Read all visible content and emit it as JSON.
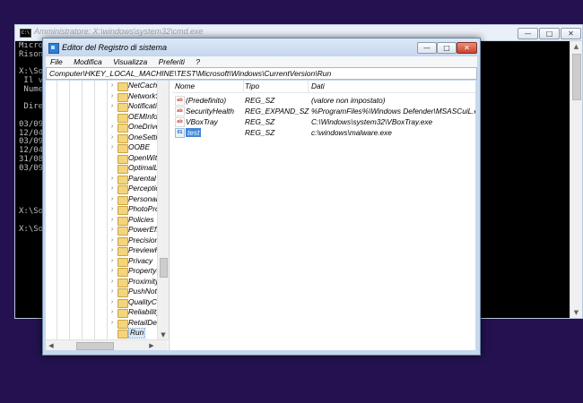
{
  "cmd": {
    "title": "Amministratore: X:\\windows\\system32\\cmd.exe",
    "icon_text": "C:\\",
    "lines": [
      "Micro",
      "Rison",
      "",
      "X:\\So",
      " Il v",
      " Nume",
      "",
      " Dire",
      "",
      "03/09",
      "12/04",
      "03/09",
      "12/04",
      "31/08",
      "03/09",
      "",
      "",
      "",
      "",
      "X:\\So",
      "",
      "X:\\So"
    ]
  },
  "regedit": {
    "title": "Editor del Registro di sistema",
    "menu": [
      "File",
      "Modifica",
      "Visualizza",
      "Preferiti",
      "?"
    ],
    "address": "Computer\\HKEY_LOCAL_MACHINE\\TEST\\Microsoft\\Windows\\CurrentVersion\\Run",
    "tree": [
      {
        "label": "NetCache",
        "expandable": true
      },
      {
        "label": "NetworkSer",
        "expandable": true
      },
      {
        "label": "Notification",
        "expandable": true
      },
      {
        "label": "OEMInform",
        "expandable": false
      },
      {
        "label": "OneDriveRa",
        "expandable": true
      },
      {
        "label": "OneSetting",
        "expandable": true
      },
      {
        "label": "OOBE",
        "expandable": true
      },
      {
        "label": "OpenWith",
        "expandable": false
      },
      {
        "label": "OptimalLay",
        "expandable": false
      },
      {
        "label": "Parental Co",
        "expandable": true
      },
      {
        "label": "PerceptionS",
        "expandable": true
      },
      {
        "label": "Personaliza",
        "expandable": true
      },
      {
        "label": "PhotoPrope",
        "expandable": true
      },
      {
        "label": "Policies",
        "expandable": true
      },
      {
        "label": "PowerEfficie",
        "expandable": true
      },
      {
        "label": "PrecisionTo",
        "expandable": true
      },
      {
        "label": "PreviewHar",
        "expandable": true
      },
      {
        "label": "Privacy",
        "expandable": true
      },
      {
        "label": "PropertySys",
        "expandable": true
      },
      {
        "label": "Proximity",
        "expandable": true
      },
      {
        "label": "PushNotific",
        "expandable": true
      },
      {
        "label": "QualityCon",
        "expandable": true
      },
      {
        "label": "Reliability",
        "expandable": true
      },
      {
        "label": "RetailDemo",
        "expandable": true
      },
      {
        "label": "Run",
        "expandable": false,
        "selected": true
      },
      {
        "label": "RunOnce",
        "expandable": false
      }
    ],
    "columns": {
      "name": "Nome",
      "type": "Tipo",
      "data": "Dati"
    },
    "values": [
      {
        "name": "(Predefinito)",
        "type": "REG_SZ",
        "data": "(valore non impostato)",
        "icon": "string-value-icon",
        "icon_text": "ab"
      },
      {
        "name": "SecurityHealth",
        "type": "REG_EXPAND_SZ",
        "data": "%ProgramFiles%\\Windows Defender\\MSASCuiL.exe",
        "icon": "string-value-icon",
        "icon_text": "ab"
      },
      {
        "name": "VBoxTray",
        "type": "REG_SZ",
        "data": "C:\\Windows\\system32\\VBoxTray.exe",
        "icon": "string-value-icon",
        "icon_text": "ab"
      },
      {
        "name": "test",
        "type": "REG_SZ",
        "data": "c:\\windows\\malware.exe",
        "icon": "binary-value-icon",
        "icon_text": "01",
        "selected": true
      }
    ]
  }
}
